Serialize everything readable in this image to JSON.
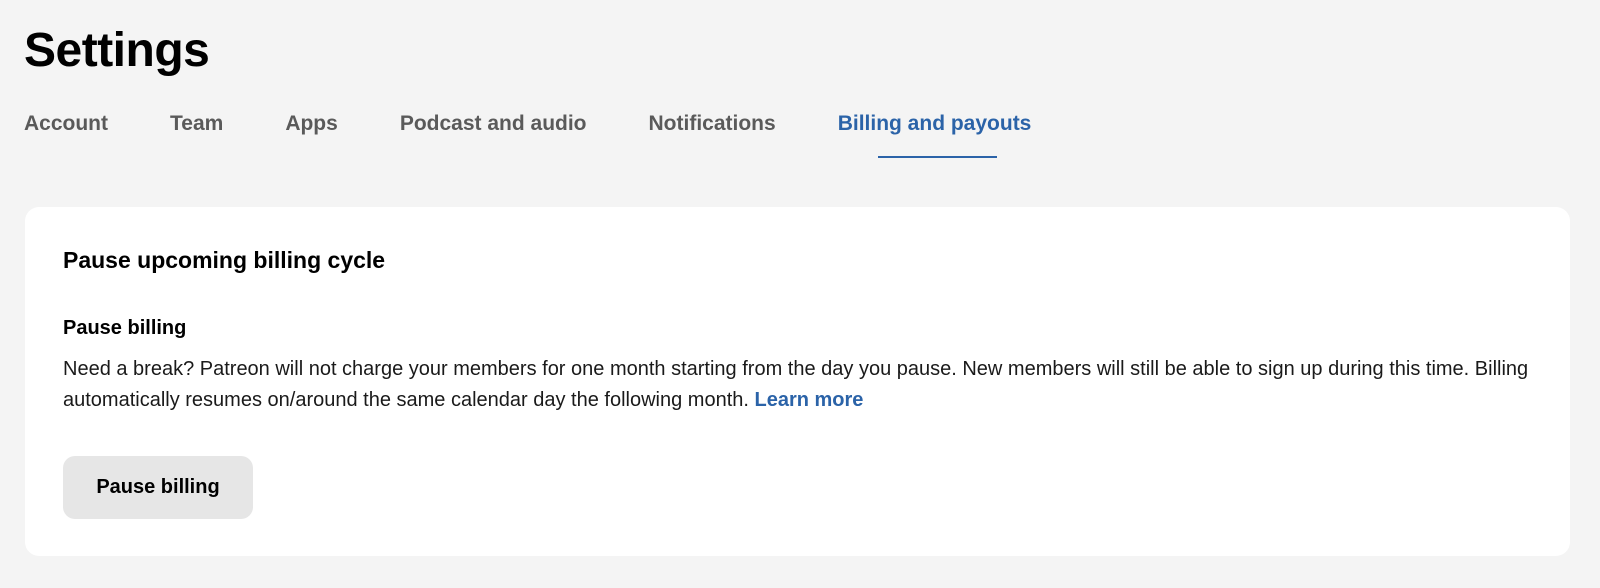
{
  "header": {
    "title": "Settings"
  },
  "tabs": [
    {
      "label": "Account",
      "active": false
    },
    {
      "label": "Team",
      "active": false
    },
    {
      "label": "Apps",
      "active": false
    },
    {
      "label": "Podcast and audio",
      "active": false
    },
    {
      "label": "Notifications",
      "active": false
    },
    {
      "label": "Billing and payouts",
      "active": true
    }
  ],
  "card": {
    "title": "Pause upcoming billing cycle",
    "section_label": "Pause billing",
    "description": "Need a break? Patreon will not charge your members for one month starting from the day you pause. New members will still be able to sign up during this time. Billing automatically resumes on/around the same calendar day the following month.",
    "learn_more_label": "Learn more",
    "button_label": "Pause billing"
  },
  "colors": {
    "background": "#f4f4f4",
    "card": "#ffffff",
    "accent": "#2b63a8",
    "tab_inactive": "#5a5a5a",
    "button_bg": "#e6e6e6"
  }
}
